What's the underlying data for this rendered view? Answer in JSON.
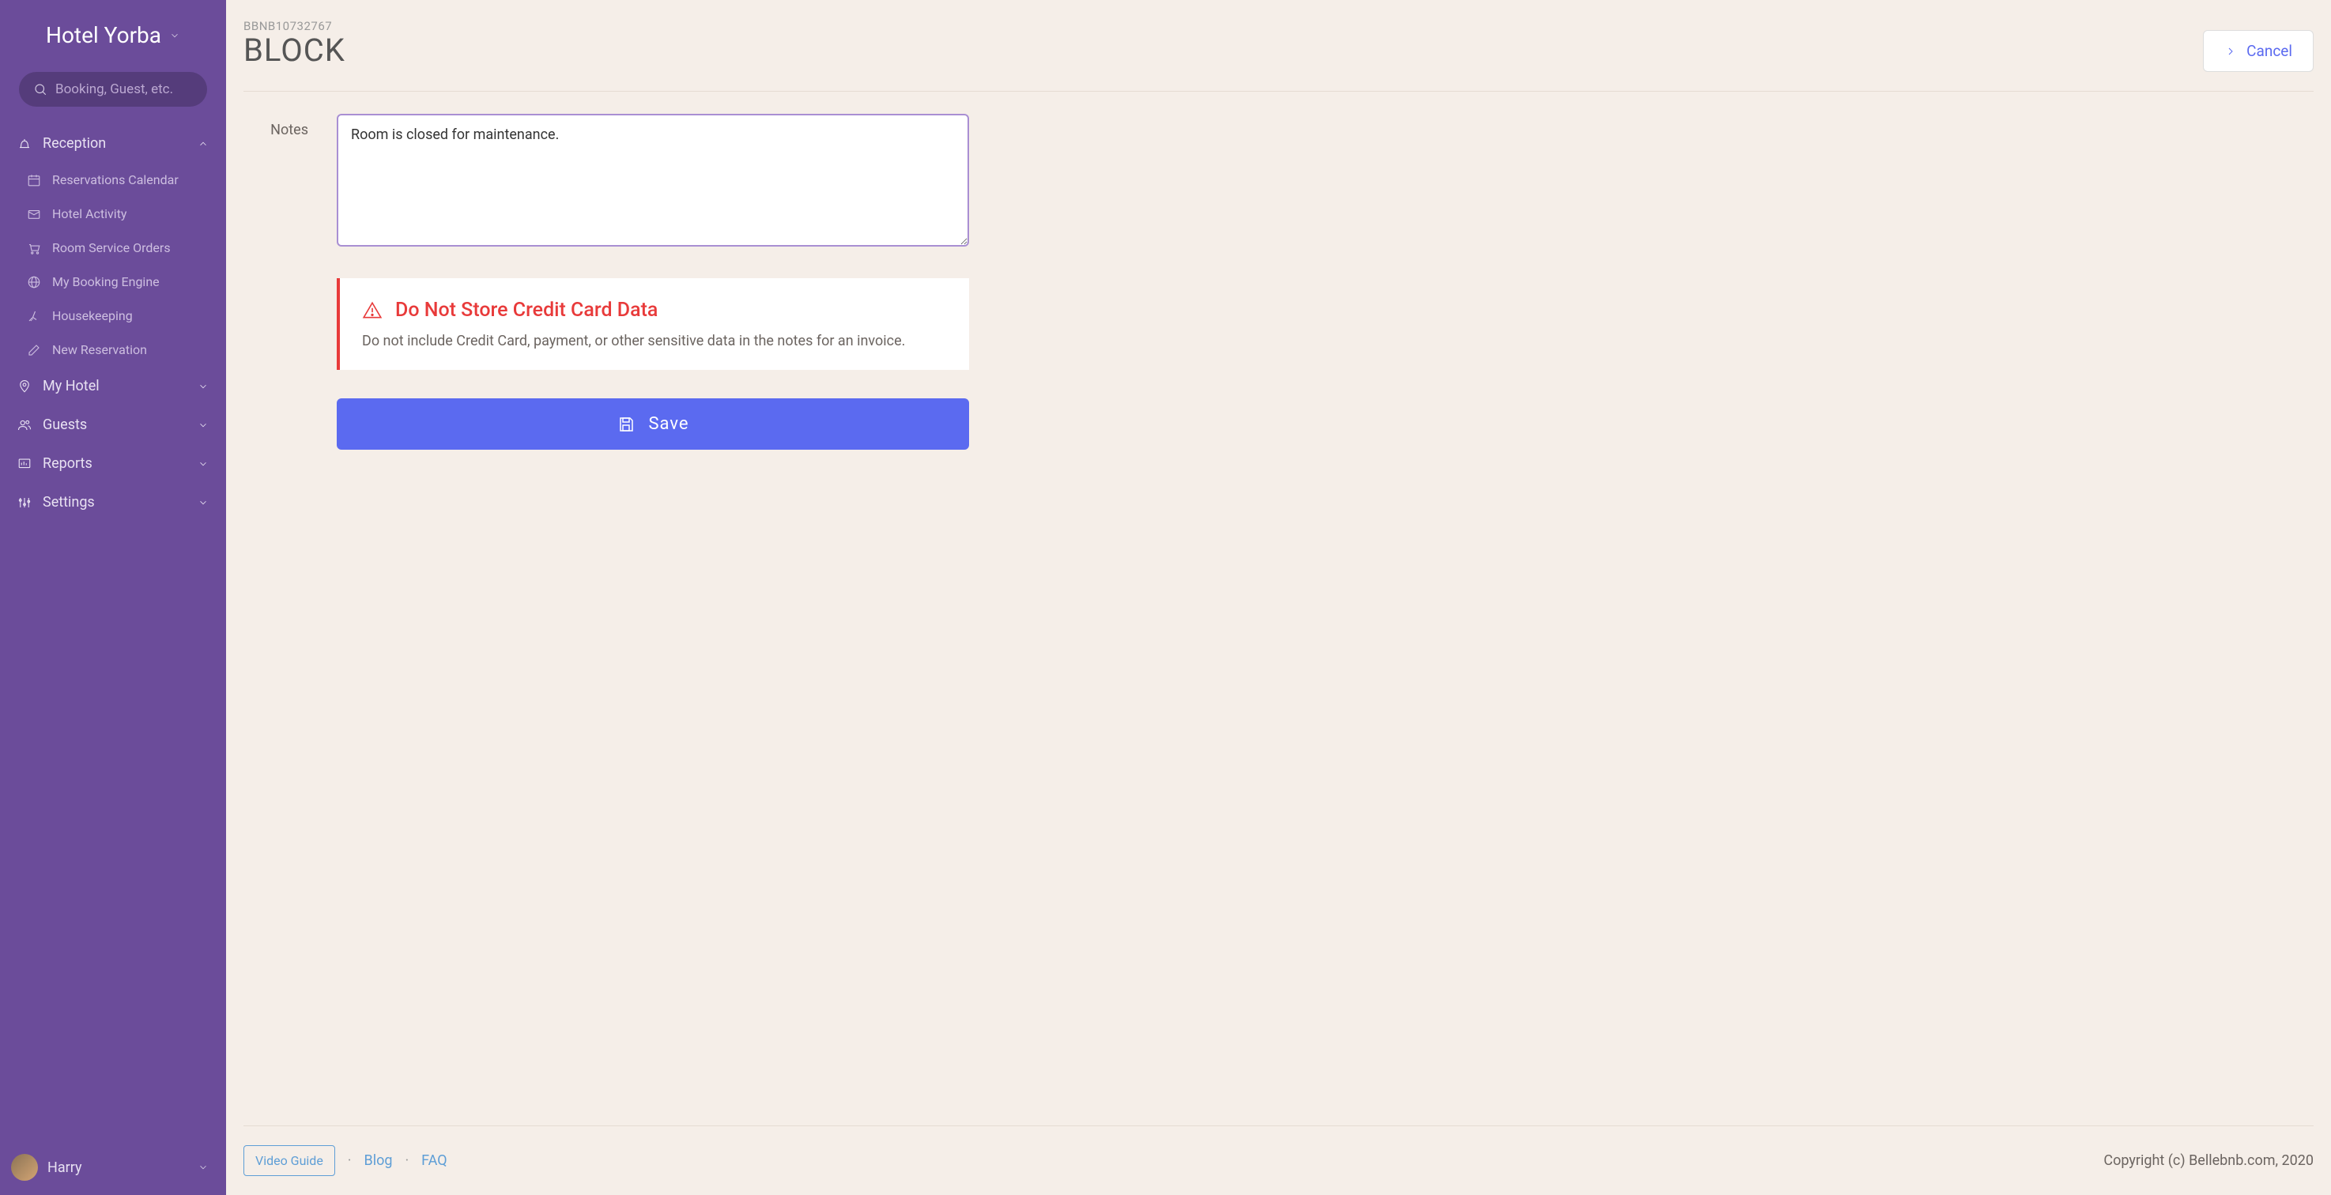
{
  "sidebar": {
    "hotel_name": "Hotel Yorba",
    "search_placeholder": "Booking, Guest, etc.",
    "sections": {
      "reception": "Reception",
      "my_hotel": "My Hotel",
      "guests": "Guests",
      "reports": "Reports",
      "settings": "Settings"
    },
    "reception_items": [
      "Reservations Calendar",
      "Hotel Activity",
      "Room Service Orders",
      "My Booking Engine",
      "Housekeeping",
      "New Reservation"
    ],
    "user_name": "Harry"
  },
  "header": {
    "booking_id": "BBNB10732767",
    "title": "BLOCK",
    "cancel_label": "Cancel"
  },
  "form": {
    "notes_label": "Notes",
    "notes_value": "Room is closed for maintenance."
  },
  "warning": {
    "title": "Do Not Store Credit Card Data",
    "text": "Do not include Credit Card, payment, or other sensitive data in the notes for an invoice."
  },
  "save_label": "Save",
  "footer": {
    "video_guide": "Video Guide",
    "blog": "Blog",
    "faq": "FAQ",
    "copyright": "Copyright (c) Bellebnb.com, 2020"
  }
}
